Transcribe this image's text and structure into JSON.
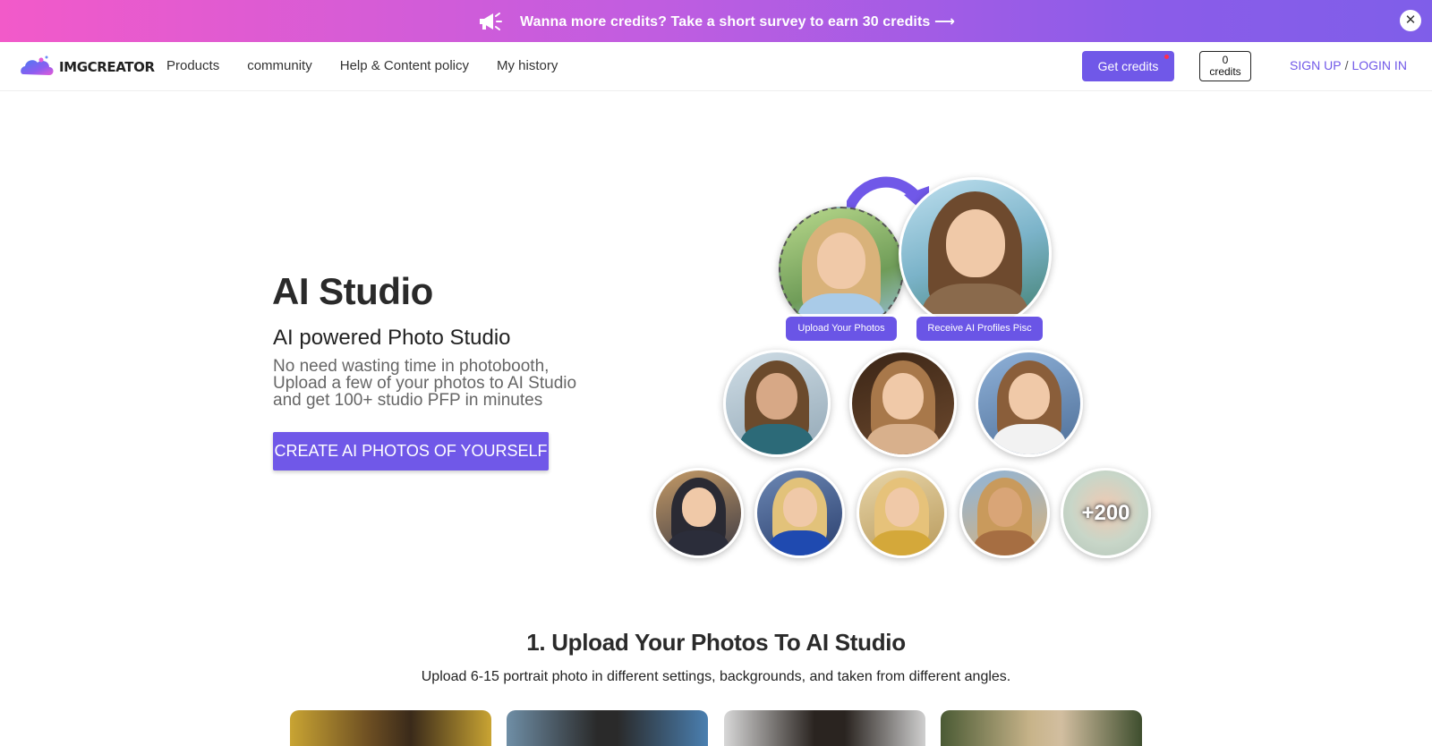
{
  "promo": {
    "text": "Wanna more credits? Take a short survey to earn 30 credits ⟶",
    "close_label": "✕",
    "icon": "megaphone-icon"
  },
  "nav": {
    "logo_text": "IMGCREATOR",
    "links": [
      "Products",
      "community",
      "Help & Content policy",
      "My history"
    ],
    "get_credits": "Get credits",
    "credits_count": "0",
    "credits_label": "credits",
    "sign_up": "SIGN UP",
    "separator": "/",
    "login": "LOGIN IN"
  },
  "hero": {
    "title": "AI Studio",
    "subtitle": "AI powered Photo Studio",
    "desc_lines": [
      "No need wasting time in photobooth,",
      "Upload a few of your photos to AI Studio",
      "and get 100+ studio PFP in minutes"
    ],
    "cta": "CREATE AI PHOTOS OF YOURSELF",
    "upload_pill": "Upload Your Photos",
    "receive_pill": "Receive AI Profiles Pisc",
    "more_count": "+200"
  },
  "section": {
    "title": "1. Upload Your Photos To AI Studio",
    "subtitle": "Upload 6-15 portrait photo in different settings, backgrounds, and taken from different angles."
  },
  "colors": {
    "accent": "#7058e8",
    "banner_start": "#f25ac9",
    "banner_end": "#7f5ee9"
  }
}
